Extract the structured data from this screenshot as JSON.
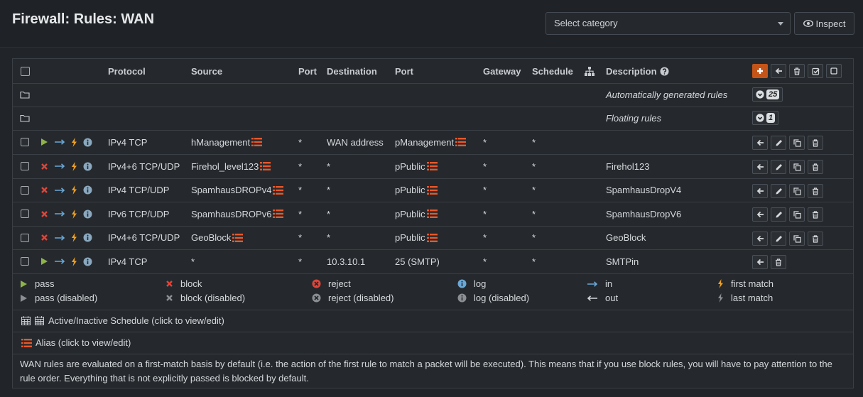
{
  "header": {
    "title": "Firewall: Rules: WAN",
    "category_select": "Select category",
    "inspect_label": "Inspect"
  },
  "table": {
    "columns": {
      "protocol": "Protocol",
      "source": "Source",
      "port": "Port",
      "destination": "Destination",
      "dest_port": "Port",
      "gateway": "Gateway",
      "schedule": "Schedule",
      "description": "Description"
    },
    "groups": [
      {
        "label": "Automatically generated rules",
        "count": "25"
      },
      {
        "label": "Floating rules",
        "count": "1"
      }
    ],
    "rules": [
      {
        "action": "pass",
        "protocol": "IPv4 TCP",
        "source": "hManagement",
        "source_alias": true,
        "port": "*",
        "destination": "WAN address",
        "dest_port": "pManagement",
        "dest_port_alias": true,
        "gateway": "*",
        "schedule": "*",
        "description": "",
        "buttons": [
          "move",
          "edit",
          "copy",
          "delete"
        ]
      },
      {
        "action": "block",
        "protocol": "IPv4+6 TCP/UDP",
        "source": "Firehol_level123",
        "source_alias": true,
        "port": "*",
        "destination": "*",
        "dest_port": "pPublic",
        "dest_port_alias": true,
        "gateway": "*",
        "schedule": "*",
        "description": "Firehol123",
        "buttons": [
          "move",
          "edit",
          "copy",
          "delete"
        ]
      },
      {
        "action": "block",
        "protocol": "IPv4 TCP/UDP",
        "source": "SpamhausDROPv4",
        "source_alias": true,
        "port": "*",
        "destination": "*",
        "dest_port": "pPublic",
        "dest_port_alias": true,
        "gateway": "*",
        "schedule": "*",
        "description": "SpamhausDropV4",
        "buttons": [
          "move",
          "edit",
          "copy",
          "delete"
        ]
      },
      {
        "action": "block",
        "protocol": "IPv6 TCP/UDP",
        "source": "SpamhausDROPv6",
        "source_alias": true,
        "port": "*",
        "destination": "*",
        "dest_port": "pPublic",
        "dest_port_alias": true,
        "gateway": "*",
        "schedule": "*",
        "description": "SpamhausDropV6",
        "buttons": [
          "move",
          "edit",
          "copy",
          "delete"
        ]
      },
      {
        "action": "block",
        "protocol": "IPv4+6 TCP/UDP",
        "source": "GeoBlock",
        "source_alias": true,
        "port": "*",
        "destination": "*",
        "dest_port": "pPublic",
        "dest_port_alias": true,
        "gateway": "*",
        "schedule": "*",
        "description": "GeoBlock",
        "buttons": [
          "move",
          "edit",
          "copy",
          "delete"
        ]
      },
      {
        "action": "pass",
        "protocol": "IPv4 TCP",
        "source": "*",
        "source_alias": false,
        "port": "*",
        "destination": "10.3.10.1",
        "dest_port": "25 (SMTP)",
        "dest_port_alias": false,
        "gateway": "*",
        "schedule": "*",
        "description": "SMTPin",
        "buttons": [
          "move",
          "delete"
        ]
      }
    ]
  },
  "legend": {
    "pass": "pass",
    "pass_disabled": "pass (disabled)",
    "block": "block",
    "block_disabled": "block (disabled)",
    "reject": "reject",
    "reject_disabled": "reject (disabled)",
    "log": "log",
    "log_disabled": "log (disabled)",
    "in": "in",
    "out": "out",
    "first_match": "first match",
    "last_match": "last match",
    "schedule": "Active/Inactive Schedule (click to view/edit)",
    "alias": "Alias (click to view/edit)"
  },
  "footer_note": "WAN rules are evaluated on a first-match basis by default (i.e. the action of the first rule to match a packet will be executed). This means that if you use block rules, you will have to pay attention to the rule order. Everything that is not explicitly passed is blocked by default.",
  "colors": {
    "pass": "#8fb34a",
    "block": "#e0453a",
    "in_arrow": "#6aa8d8",
    "lightning": "#f0a020",
    "log_info": "#6aa8d8",
    "alias_icon": "#e8572a",
    "add_button": "#c45418"
  }
}
